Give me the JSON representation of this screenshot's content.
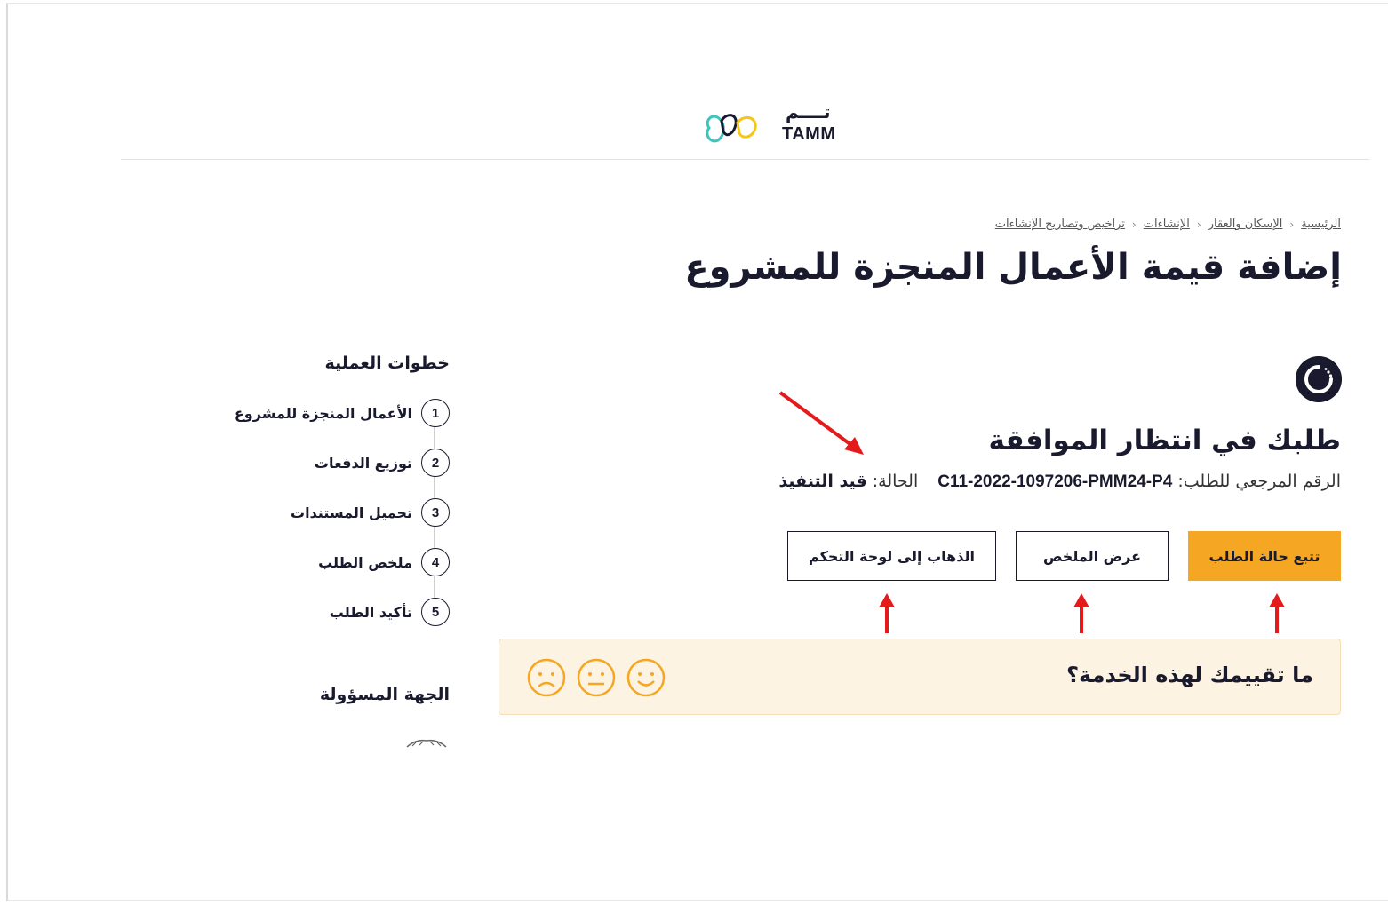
{
  "header": {
    "logo_latin": "TAMM",
    "logo_arabic": "تــــم"
  },
  "breadcrumb": [
    "الرئيسية",
    "الإسكان والعقار",
    "الإنشاءات",
    "تراخيص وتصاريح الإنشاءات"
  ],
  "page_title": "إضافة قيمة الأعمال المنجزة للمشروع",
  "status": {
    "heading": "طلبك في انتظار الموافقة",
    "ref_label": "الرقم المرجعي للطلب:",
    "ref_value": "C11-2022-1097206-PMM24-P4",
    "status_label": "الحالة:",
    "status_value": "قيد التنفيذ"
  },
  "actions": {
    "track": "تتبع حالة الطلب",
    "summary": "عرض الملخص",
    "dashboard": "الذهاب إلى لوحة التحكم"
  },
  "rating": {
    "question": "ما تقييمك لهذه الخدمة؟",
    "faces": [
      "happy-face-icon",
      "neutral-face-icon",
      "sad-face-icon"
    ]
  },
  "sidebar": {
    "steps_title": "خطوات العملية",
    "steps": [
      {
        "num": "1",
        "label": "الأعمال المنجزة للمشروع"
      },
      {
        "num": "2",
        "label": "توزيع الدفعات"
      },
      {
        "num": "3",
        "label": "تحميل المستندات"
      },
      {
        "num": "4",
        "label": "ملخص الطلب"
      },
      {
        "num": "5",
        "label": "تأكيد الطلب"
      }
    ],
    "entity_title": "الجهة المسؤولة"
  },
  "colors": {
    "primary": "#f5a623",
    "navy": "#1a1a2e",
    "rating_bg": "#fdf3e2",
    "annotation_arrow": "#e31b1b",
    "logo_teal": "#3cc4c0",
    "logo_yellow": "#f5c518"
  }
}
